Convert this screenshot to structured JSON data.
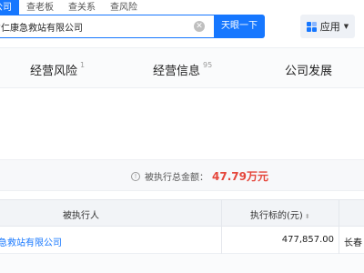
{
  "search": {
    "tabs": [
      "公司",
      "查老板",
      "查关系",
      "查风险"
    ],
    "query": "林省仁康急救站有限公司",
    "clear_glyph": "✕",
    "button_label": "天眼一下"
  },
  "app_menu": {
    "label": "应用",
    "caret": "▼"
  },
  "section_nav": [
    {
      "label": "经营风险",
      "count": "1"
    },
    {
      "label": "经营信息",
      "count": "95"
    },
    {
      "label": "公司发展",
      "count": ""
    }
  ],
  "summary": {
    "info_glyph": "!",
    "label": "被执行总金额：",
    "value": "47.79万元"
  },
  "table": {
    "headers": [
      "被执行人",
      "执行标的(元)"
    ],
    "sort_glyph": "⬍",
    "rows": [
      {
        "name": "急救站有限公司",
        "amount": "477,857.00",
        "court": "长春"
      }
    ]
  },
  "colors": {
    "accent": "#1677ff",
    "amount_red": "#e5463b"
  }
}
